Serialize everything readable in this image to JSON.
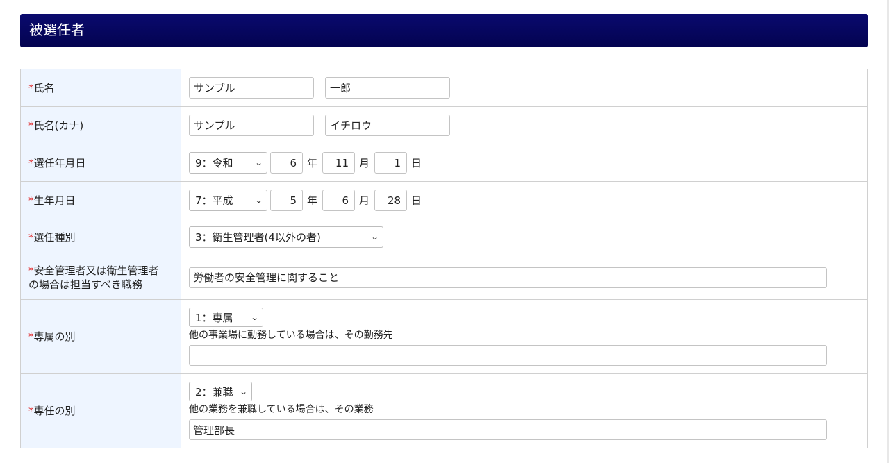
{
  "section": {
    "title": "被選任者"
  },
  "required_mark": "*",
  "fields": {
    "name": {
      "label": "氏名",
      "last": "サンプル",
      "first": "一郎"
    },
    "kana": {
      "label": "氏名(カナ)",
      "last": "サンプル",
      "first": "イチロウ"
    },
    "appoint_date": {
      "label": "選任年月日",
      "era": "9：令和",
      "year": "6",
      "month": "11",
      "day": "1"
    },
    "birth_date": {
      "label": "生年月日",
      "era": "7：平成",
      "year": "5",
      "month": "6",
      "day": "28"
    },
    "appoint_type": {
      "label": "選任種別",
      "value": "3：衛生管理者(4以外の者)"
    },
    "duty": {
      "label_line1": "安全管理者又は衛生管理者",
      "label_line2": "の場合は担当すべき職務",
      "value": "労働者の安全管理に関すること"
    },
    "exclusive": {
      "label": "専属の別",
      "value": "1：専属",
      "note": "他の事業場に勤務している場合は、その勤務先",
      "workplace": ""
    },
    "fulltime": {
      "label": "専任の別",
      "value": "2：兼職",
      "note": "他の業務を兼職している場合は、その業務",
      "other_job": "管理部長"
    }
  },
  "units": {
    "year": "年",
    "month": "月",
    "day": "日"
  },
  "icons": {
    "dropdown": "chevron-down-icon"
  },
  "colors": {
    "header_bg": "#0a0a6e",
    "label_bg": "#eef5ff",
    "required": "#e02020"
  }
}
